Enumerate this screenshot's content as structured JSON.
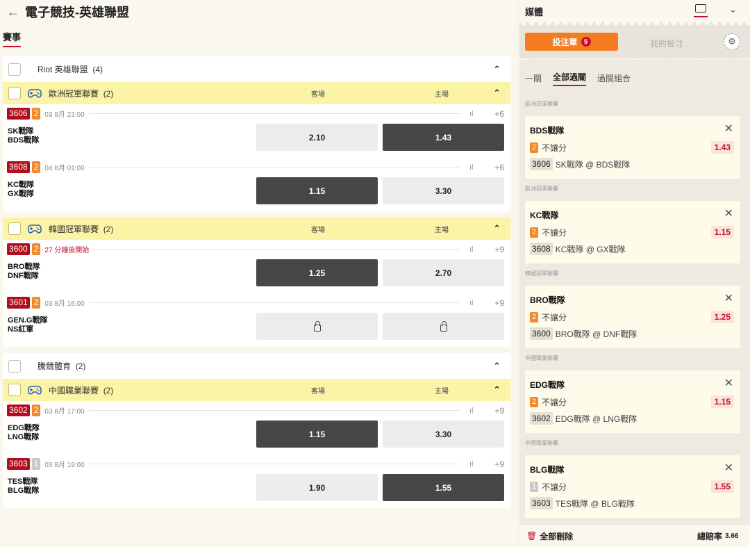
{
  "header": {
    "back_icon": "←",
    "title": "電子競技-英雄聯盟"
  },
  "tabs": {
    "events": "賽事"
  },
  "categories": [
    {
      "label": "Riot 英雄聯盟",
      "count": "(4)"
    },
    {
      "label": "騰競體育",
      "count": "(2)"
    }
  ],
  "leagues": [
    {
      "name": "歐洲冠軍聯賽",
      "count": "(2)",
      "away": "客場",
      "home": "主場"
    },
    {
      "name": "韓國冠軍聯賽",
      "count": "(2)",
      "away": "客場",
      "home": "主場"
    },
    {
      "name": "中國職業聯賽",
      "count": "(2)",
      "away": "客場",
      "home": "主場"
    }
  ],
  "matches": [
    {
      "id": "3606",
      "num": "2",
      "time": "03 8月  23:00",
      "more": "+6",
      "team1": "SK戰隊",
      "team2": "BDS戰隊",
      "away_odd": "2.10",
      "home_odd": "1.43"
    },
    {
      "id": "3608",
      "num": "2",
      "time": "04 8月  01:00",
      "more": "+6",
      "team1": "KC戰隊",
      "team2": "GX戰隊",
      "away_odd": "1.15",
      "home_odd": "3.30"
    },
    {
      "id": "3600",
      "num": "2",
      "time": "27 分鐘後開始",
      "more": "+9",
      "team1": "BRO戰隊",
      "team2": "DNF戰隊",
      "away_odd": "1.25",
      "home_odd": "2.70"
    },
    {
      "id": "3601",
      "num": "2",
      "time": "03 8月  16:00",
      "more": "+9",
      "team1": "GEN.G戰隊",
      "team2": "NS紅軍",
      "away_odd": "",
      "home_odd": ""
    },
    {
      "id": "3602",
      "num": "2",
      "time": "03 8月  17:00",
      "more": "+9",
      "team1": "EDG戰隊",
      "team2": "LNG戰隊",
      "away_odd": "1.15",
      "home_odd": "3.30"
    },
    {
      "id": "3603",
      "num": "1",
      "time": "03 8月  19:00",
      "more": "+9",
      "team1": "TES戰隊",
      "team2": "BLG戰隊",
      "away_odd": "1.90",
      "home_odd": "1.55"
    }
  ],
  "sidebar": {
    "title": "媒體",
    "bet_slip": "投注單",
    "bet_count": "5",
    "my_bets": "我的投注",
    "tabs": [
      "一關",
      "全部過關",
      "過關組合"
    ],
    "bets": [
      {
        "league": "歐洲冠軍聯賽",
        "team": "BDS戰隊",
        "num": "2",
        "type": "不讓分",
        "odd": "1.43",
        "match_id": "3606",
        "match": "SK戰隊 @ BDS戰隊"
      },
      {
        "league": "歐洲冠軍聯賽",
        "team": "KC戰隊",
        "num": "2",
        "type": "不讓分",
        "odd": "1.15",
        "match_id": "3608",
        "match": "KC戰隊 @ GX戰隊"
      },
      {
        "league": "韓國冠軍聯賽",
        "team": "BRO戰隊",
        "num": "2",
        "type": "不讓分",
        "odd": "1.25",
        "match_id": "3600",
        "match": "BRO戰隊 @ DNF戰隊"
      },
      {
        "league": "中國職業聯賽",
        "team": "EDG戰隊",
        "num": "2",
        "type": "不讓分",
        "odd": "1.15",
        "match_id": "3602",
        "match": "EDG戰隊 @ LNG戰隊"
      },
      {
        "league": "中國職業聯賽",
        "team": "BLG戰隊",
        "num": "1",
        "type": "不讓分",
        "odd": "1.55",
        "match_id": "3603",
        "match": "TES戰隊 @ BLG戰隊"
      }
    ],
    "delete_all": "全部刪除",
    "total_label": "總賠率",
    "total_value": "3.66"
  },
  "colors": {
    "accent": "#c8102e",
    "orange": "#f47b20",
    "league_bg": "#fbf3a6"
  }
}
